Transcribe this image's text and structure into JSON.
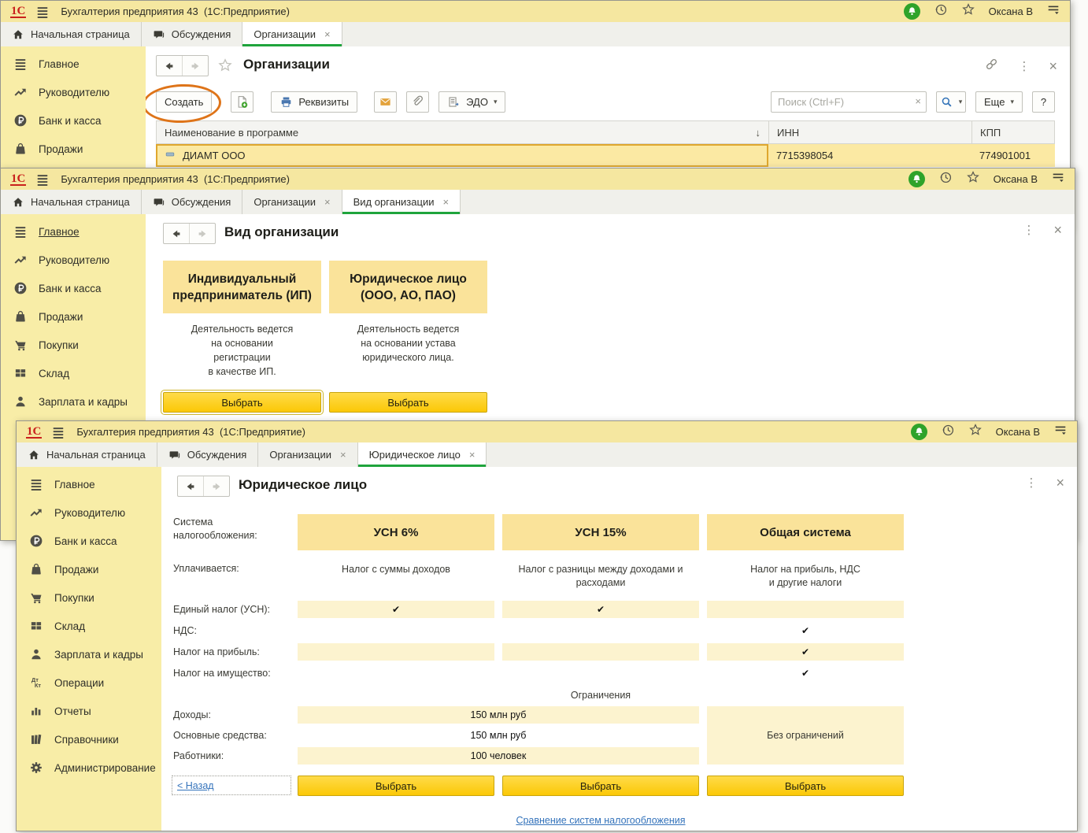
{
  "app": {
    "logo": "1С",
    "title": "Бухгалтерия предприятия 43  (1С:Предприятие)",
    "user": "Оксана В"
  },
  "sidebar_items": [
    {
      "icon": "menu-icon",
      "label": "Главное"
    },
    {
      "icon": "trend-icon",
      "label": "Руководителю"
    },
    {
      "icon": "ruble-icon",
      "label": "Банк и касса"
    },
    {
      "icon": "bag-icon",
      "label": "Продажи"
    },
    {
      "icon": "cart-icon",
      "label": "Покупки"
    },
    {
      "icon": "grid-icon",
      "label": "Склад"
    },
    {
      "icon": "person-icon",
      "label": "Зарплата и кадры"
    },
    {
      "icon": "dtkt-icon",
      "label": "Операции"
    },
    {
      "icon": "chart-icon",
      "label": "Отчеты"
    },
    {
      "icon": "books-icon",
      "label": "Справочники"
    },
    {
      "icon": "gear-icon",
      "label": "Администрирование"
    }
  ],
  "windows": [
    {
      "id": "organizations",
      "title": "Организации",
      "sidebar_count": 4,
      "underline_first": false,
      "tabs": [
        {
          "icon": "home-icon",
          "label": "Начальная страница"
        },
        {
          "icon": "chat-icon",
          "label": "Обсуждения"
        },
        {
          "label": "Организации",
          "close": true,
          "active": true
        }
      ],
      "toolbar": {
        "create": "Создать",
        "requisites": "Реквизиты",
        "edo": "ЭДО",
        "search_placeholder": "Поиск (Ctrl+F)",
        "more": "Еще",
        "help": "?"
      },
      "table": {
        "columns": [
          "Наименование в программе",
          "ИНН",
          "КПП"
        ],
        "rows": [
          {
            "name": "ДИАМТ ООО",
            "inn": "7715398054",
            "kpp": "774901001"
          }
        ]
      }
    },
    {
      "id": "orgtype",
      "title": "Вид организации",
      "sidebar_count": 7,
      "underline_first": true,
      "tabs": [
        {
          "icon": "home-icon",
          "label": "Начальная страница"
        },
        {
          "icon": "chat-icon",
          "label": "Обсуждения"
        },
        {
          "label": "Организации",
          "close": true
        },
        {
          "label": "Вид организации",
          "close": true,
          "active": true
        }
      ],
      "cards": [
        {
          "header": "Индивидуальный предприниматель (ИП)",
          "desc_lines": [
            "Деятельность ведется",
            "на основании",
            "регистрации",
            "в качестве ИП."
          ],
          "button": "Выбрать",
          "focused": true
        },
        {
          "header": "Юридическое лицо (ООО, АО, ПАО)",
          "desc_lines": [
            "Деятельность ведется",
            "на основании устава",
            "юридического лица."
          ],
          "button": "Выбрать",
          "focused": false
        }
      ]
    },
    {
      "id": "legal",
      "title": "Юридическое лицо",
      "sidebar_count": 11,
      "underline_first": false,
      "tabs": [
        {
          "icon": "home-icon",
          "label": "Начальная страница"
        },
        {
          "icon": "chat-icon",
          "label": "Обсуждения"
        },
        {
          "label": "Организации",
          "close": true
        },
        {
          "label": "Юридическое лицо",
          "close": true,
          "active": true
        }
      ],
      "compare": {
        "system_label": "Система налогообложения:",
        "pays_label": "Уплачивается:",
        "systems": [
          {
            "name": "УСН 6%",
            "pays_lines": [
              "Налог с суммы доходов"
            ]
          },
          {
            "name": "УСН 15%",
            "pays_lines": [
              "Налог с разницы между доходами и",
              "расходами"
            ]
          },
          {
            "name": "Общая система",
            "pays_lines": [
              "Налог на прибыль, НДС",
              "и другие налоги"
            ]
          }
        ],
        "tax_rows": [
          {
            "label": "Единый налог (УСН):",
            "checks": [
              true,
              true,
              false
            ],
            "stripe": true
          },
          {
            "label": "НДС:",
            "checks": [
              false,
              false,
              true
            ],
            "stripe": false
          },
          {
            "label": "Налог на прибыль:",
            "checks": [
              false,
              false,
              true
            ],
            "stripe": true
          },
          {
            "label": "Налог на имущество:",
            "checks": [
              false,
              false,
              true
            ],
            "stripe": false
          }
        ],
        "limits_header": "Ограничения",
        "limit_rows": [
          {
            "label": "Доходы:",
            "value": "150 млн руб",
            "stripe": true
          },
          {
            "label": "Основные средства:",
            "value": "150 млн руб",
            "stripe": false
          },
          {
            "label": "Работники:",
            "value": "100 человек",
            "stripe": true
          }
        ],
        "no_limits": "Без ограничений",
        "back_link": "< Назад",
        "select_button": "Выбрать",
        "compare_link": "Сравнение систем налогообложения"
      }
    }
  ],
  "colors": {
    "titlebar": "#F5E7A0",
    "sidebar": "#F8EDA7",
    "active_tab_underline": "#1FA43C",
    "selected_row": "#FBE9A3",
    "selected_cell_border": "#DFA72E",
    "card_header": "#FAE39A",
    "stripe": "#FCF3CF",
    "gold_button": "#FDCF12",
    "link": "#3473BB",
    "annotation_ellipse": "#DE7419",
    "notification_green": "#2FA32A"
  }
}
